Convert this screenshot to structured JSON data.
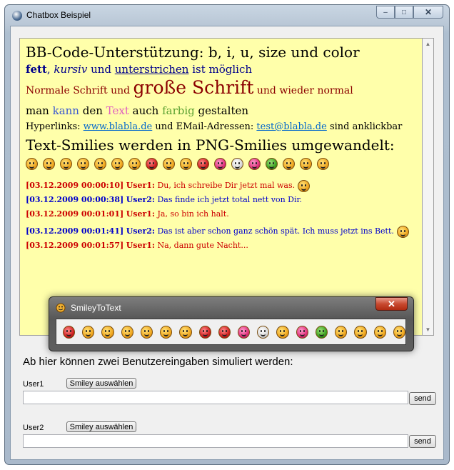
{
  "window": {
    "title": "Chatbox Beispiel",
    "minimize": "–",
    "maximize": "□",
    "close": "✕"
  },
  "chat": {
    "line1": "BB-Code-Unterstützung: b, i, u, size und color",
    "line2": {
      "bold": "fett",
      "sep": ", ",
      "italic": "kursiv",
      "and": " und ",
      "underline": "unterstrichen",
      "rest": " ist möglich"
    },
    "line3": {
      "pre": "Normale Schrift und ",
      "big": "große Schrift",
      "post": " und wieder normal"
    },
    "line4": {
      "w1": "man ",
      "w2": "kann",
      "w3": " den ",
      "w4": "Text",
      "w5": " auch ",
      "w6": "farbig",
      "w7": " gestalten"
    },
    "line5": {
      "pre": "Hyperlinks: ",
      "link1": "www.blabla.de",
      "mid": " und EMail-Adressen: ",
      "link2": "test@blabla.de",
      "post": " sind anklickbar"
    },
    "line6": "Text-Smilies werden in PNG-Smilies umgewandelt:",
    "smiley_row": [
      "smile",
      "grin",
      "wink",
      "squint",
      "neutral",
      "surprised",
      "tongue",
      "angry",
      "cool",
      "teeth",
      "love",
      "kiss",
      "sick",
      "pink",
      "green",
      "calm",
      "laugh",
      "shout"
    ],
    "messages": [
      {
        "user": "u1",
        "ts": "[03.12.2009 00:00:10]",
        "name": "User1:",
        "text": "Du, ich schreibe Dir jetzt mal was.",
        "smiley": true,
        "gap": false
      },
      {
        "user": "u2",
        "ts": "[03.12.2009 00:00:38]",
        "name": "User2:",
        "text": "Das finde ich jetzt total nett von Dir.",
        "smiley": false,
        "gap": false
      },
      {
        "user": "u1",
        "ts": "[03.12.2009 00:01:01]",
        "name": "User1:",
        "text": "Ja, so bin ich halt.",
        "smiley": false,
        "gap": false
      },
      {
        "user": "u2",
        "ts": "[03.12.2009 00:01:41]",
        "name": "User2:",
        "text": "Das ist aber schon ganz schön spät. Ich muss jetzt ins Bett.",
        "smiley": true,
        "gap": true
      },
      {
        "user": "u1",
        "ts": "[03.12.2009 00:01:57]",
        "name": "User1:",
        "text": "Na, dann gute Nacht...",
        "smiley": false,
        "gap": false
      }
    ]
  },
  "picker": {
    "title": "SmileyToText",
    "close": "✕",
    "smileys": [
      "angry",
      "cool",
      "teeth",
      "smile",
      "wink",
      "grin",
      "surprised",
      "love",
      "heart",
      "kiss",
      "shock",
      "neutral",
      "pink",
      "green",
      "calm",
      "smile",
      "laugh",
      "shout"
    ]
  },
  "form": {
    "info": "Ab hier können zwei Benutzereingaben simuliert werden:",
    "user1_label": "User1",
    "user2_label": "User2",
    "smiley_button": "Smiley auswählen",
    "send_button": "send",
    "user1_value": "",
    "user2_value": ""
  }
}
